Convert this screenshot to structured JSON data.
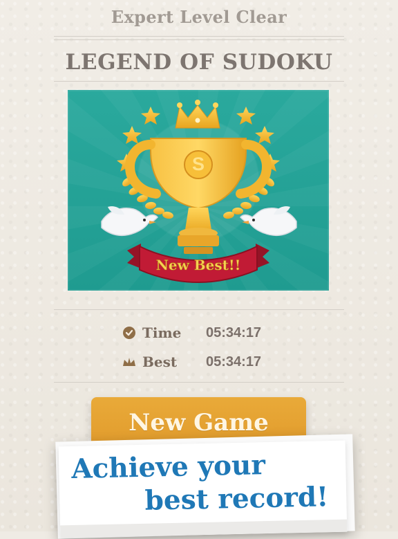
{
  "header": {
    "subtitle": "Expert Level Clear",
    "title": "LEGEND OF SUDOKU"
  },
  "trophy_card": {
    "banner_text": "New Best!!",
    "trophy_letter": "S"
  },
  "stats": [
    {
      "icon": "clock-icon",
      "label": "Time",
      "value": "05:34:17"
    },
    {
      "icon": "crown-icon",
      "label": "Best",
      "value": "05:34:17"
    }
  ],
  "actions": {
    "new_game_label": "New Game"
  },
  "promo": {
    "line1": "Achieve your",
    "line2": "best record!"
  },
  "colors": {
    "background": "#efebe4",
    "teal": "#22a196",
    "gold": "#f2b52f",
    "red_banner": "#b9162f",
    "promo_blue": "#1f78b6",
    "button_orange": "#e3a233"
  }
}
